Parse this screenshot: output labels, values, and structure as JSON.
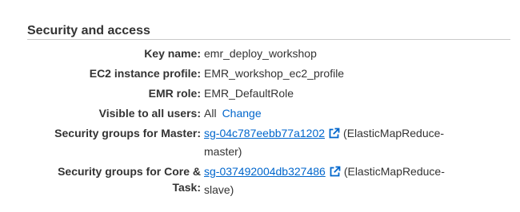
{
  "section": {
    "title": "Security and access"
  },
  "rows": {
    "key_name": {
      "label": "Key name:",
      "value": "emr_deploy_workshop"
    },
    "ec2_profile": {
      "label": "EC2 instance profile:",
      "value": "EMR_workshop_ec2_profile"
    },
    "emr_role": {
      "label": "EMR role:",
      "value": "EMR_DefaultRole"
    },
    "visible": {
      "label": "Visible to all users:",
      "value": "All",
      "action": "Change"
    },
    "sg_master": {
      "label": "Security groups for Master:",
      "link": "sg-04c787eebb77a1202",
      "suffix_1": "(ElasticMapReduce-",
      "suffix_2": "master)",
      "icon": "external-link-icon"
    },
    "sg_core": {
      "label_1": "Security groups for Core &",
      "label_2": "Task:",
      "link": "sg-037492004db327486",
      "suffix_1": "(ElasticMapReduce-",
      "suffix_2": "slave)",
      "icon": "external-link-icon"
    }
  },
  "colors": {
    "text": "#333333",
    "link": "#0066cc",
    "divider": "#c9c9c9"
  }
}
